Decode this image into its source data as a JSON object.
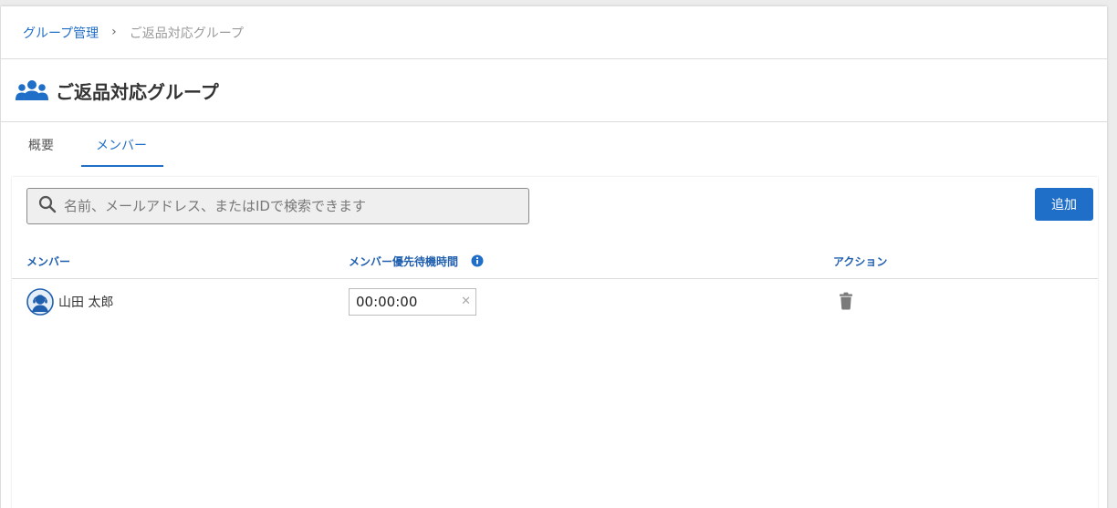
{
  "breadcrumb": {
    "parent": "グループ管理",
    "separator": "›",
    "current": "ご返品対応グループ"
  },
  "header": {
    "title": "ご返品対応グループ",
    "icon": "people-group-icon"
  },
  "tabs": [
    {
      "label": "概要",
      "active": false
    },
    {
      "label": "メンバー",
      "active": true
    }
  ],
  "search": {
    "placeholder": "名前、メールアドレス、またはIDで検索できます",
    "value": ""
  },
  "toolbar": {
    "add_label": "追加"
  },
  "table": {
    "columns": [
      "メンバー",
      "メンバー優先待機時間",
      "アクション"
    ],
    "rows": [
      {
        "name": "山田 太郎",
        "priority_wait": "00:00:00"
      }
    ]
  },
  "colors": {
    "accent": "#1f6ec7",
    "header_text": "#1f5fae",
    "trash": "#7a7a7a"
  }
}
